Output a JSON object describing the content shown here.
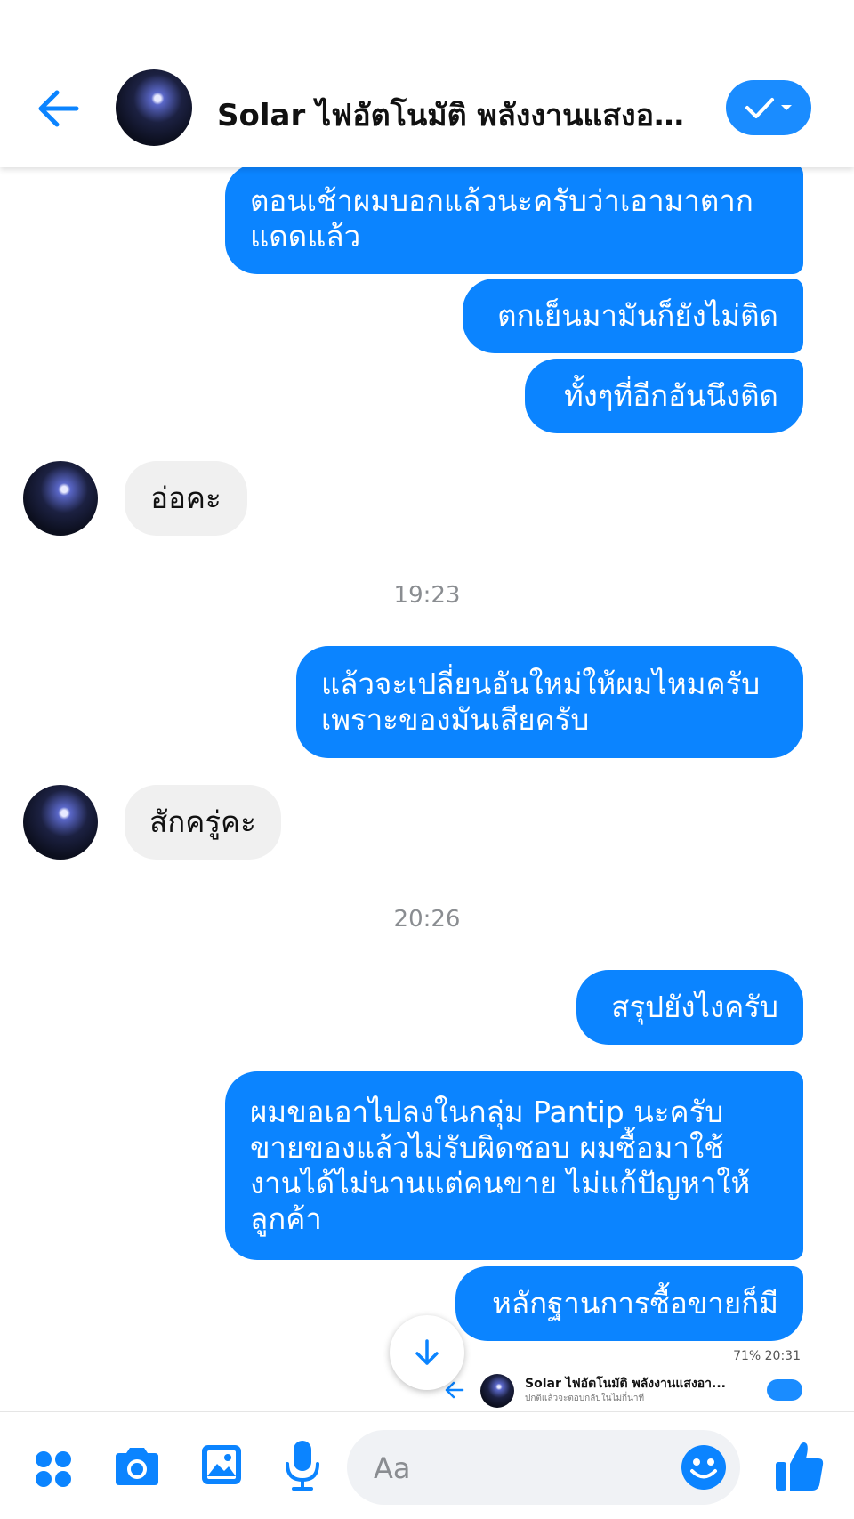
{
  "header": {
    "title": "Solar ไฟอัตโนมัติ พลังงานแสงอา...",
    "colors": {
      "accent": "#0b84ff",
      "button": "#1a8cff"
    }
  },
  "messages": [
    {
      "side": "out",
      "lines": [
        "ตอนเช้าผมบอกแล้วนะครับว่าเอามาตาก",
        "แดดแล้ว"
      ]
    },
    {
      "side": "out",
      "lines": [
        "ตกเย็นมามันก็ยังไม่ติด"
      ]
    },
    {
      "side": "out",
      "lines": [
        "ทั้งๆที่อีกอันนึงติด"
      ]
    },
    {
      "side": "in",
      "lines": [
        "อ่อคะ"
      ]
    },
    {
      "timestamp": "19:23"
    },
    {
      "side": "out",
      "lines": [
        "แล้วจะเปลี่ยนอันใหม่ให้ผมไหมครับ",
        "เพราะของมันเสียครับ"
      ]
    },
    {
      "side": "in",
      "lines": [
        "สักครู่คะ"
      ]
    },
    {
      "timestamp": "20:26"
    },
    {
      "side": "out",
      "lines": [
        "สรุปยังไงครับ"
      ]
    },
    {
      "side": "out",
      "lines": [
        "ผมขอเอาไปลงในกลุ่ม Pantip นะครับ",
        "ขายของแล้วไม่รับผิดชอบ ผมซื้อมาใช้",
        "งานได้ไม่นานแต่คนขาย ไม่แก้ปัญหาให้",
        "ลูกค้า"
      ]
    },
    {
      "side": "out",
      "lines": [
        "หลักฐานการซื้อขายก็มี"
      ]
    }
  ],
  "screenshot_preview": {
    "status": "71% 20:31",
    "title": "Solar ไฟอัตโนมัติ พลังงานแสงอา...",
    "subtitle": "ปกติแล้วจะตอบกลับในไม่กี่นาที"
  },
  "composer": {
    "placeholder": "Aa",
    "icons": [
      "apps-icon",
      "camera-icon",
      "gallery-icon",
      "microphone-icon",
      "emoji-icon",
      "like-icon"
    ]
  }
}
